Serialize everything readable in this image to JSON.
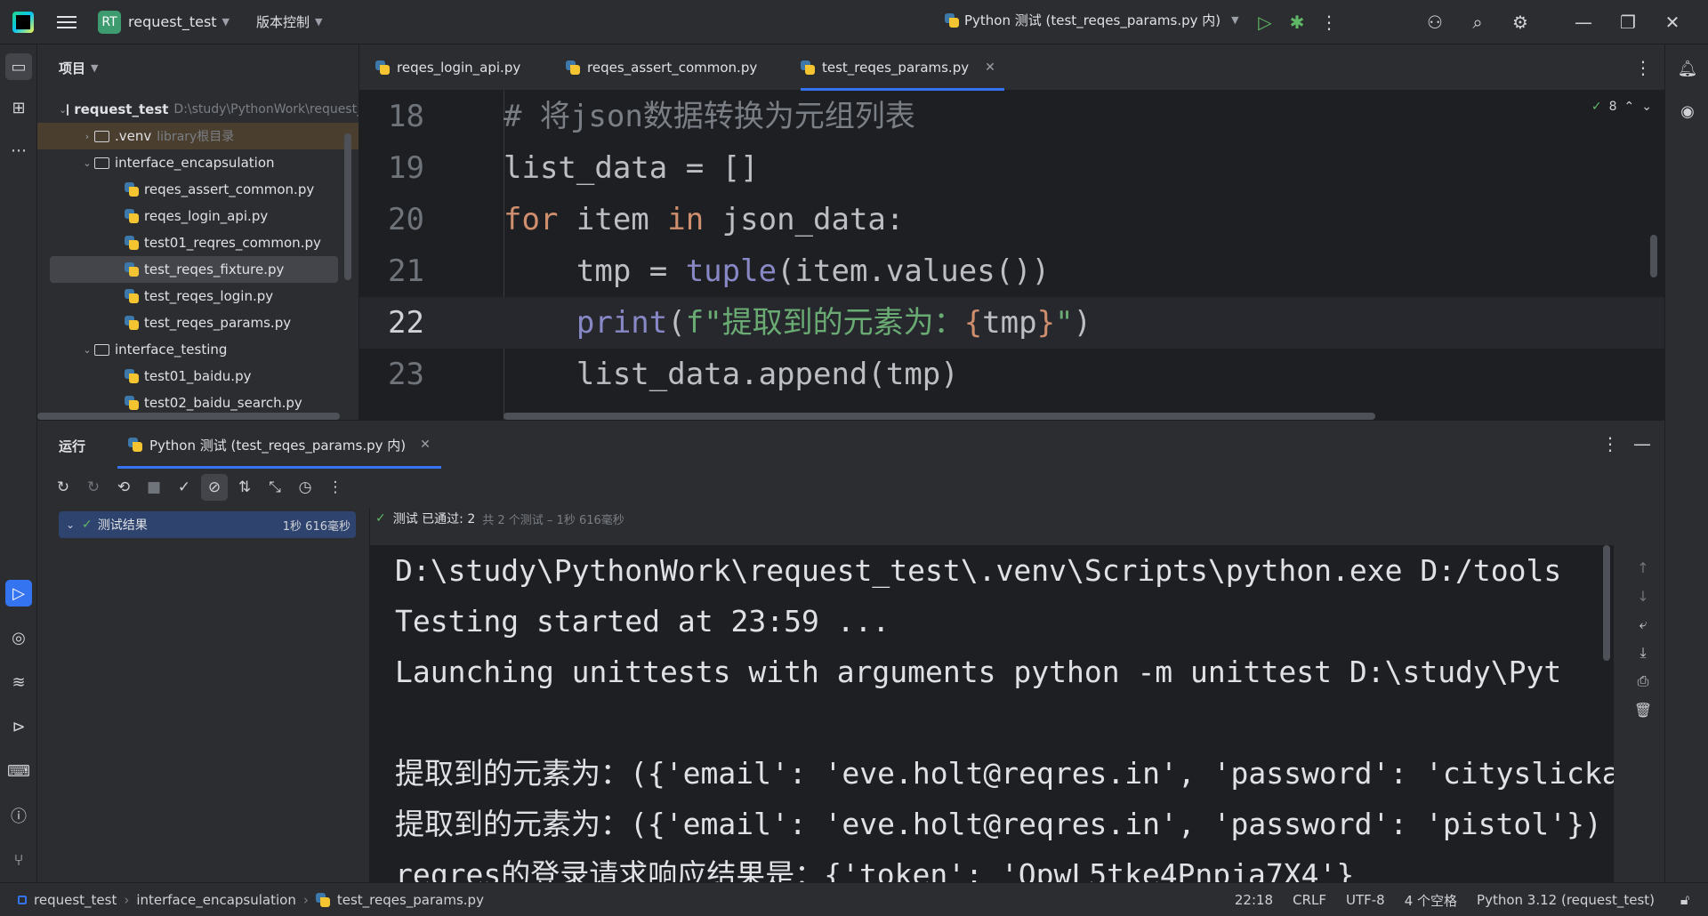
{
  "titlebar": {
    "project_badge": "RT",
    "project_name": "request_test",
    "vcs_label": "版本控制",
    "run_config": "Python 测试 (test_reqes_params.py 内)"
  },
  "project_panel": {
    "title": "项目",
    "rows": [
      {
        "label": "request_test",
        "extra": "D:\\study\\PythonWork\\request_test"
      },
      {
        "label": ".venv",
        "extra": "library根目录"
      },
      {
        "label": "interface_encapsulation"
      },
      {
        "label": "reqes_assert_common.py"
      },
      {
        "label": "reqes_login_api.py"
      },
      {
        "label": "test01_reqres_common.py"
      },
      {
        "label": "test_reqes_fixture.py"
      },
      {
        "label": "test_reqes_login.py"
      },
      {
        "label": "test_reqes_params.py"
      },
      {
        "label": "interface_testing"
      },
      {
        "label": "test01_baidu.py"
      },
      {
        "label": "test02_baidu_search.py"
      }
    ]
  },
  "editor": {
    "tabs": [
      {
        "label": "reqes_login_api.py"
      },
      {
        "label": "reqes_assert_common.py"
      },
      {
        "label": "test_reqes_params.py"
      }
    ],
    "inspection_count": "8",
    "lines": {
      "l18": {
        "num": "18",
        "comment": "# 将json数据转换为元组列表"
      },
      "l19": {
        "num": "19",
        "code": "list_data = []"
      },
      "l20": {
        "num": "20",
        "kw_for": "for",
        "item": " item ",
        "kw_in": "in",
        "rest": " json_data:"
      },
      "l21": {
        "num": "21",
        "lhs": "    tmp = ",
        "fn": "tuple",
        "rest": "(item.values())"
      },
      "l22": {
        "num": "22",
        "indent": "    ",
        "fn": "print",
        "p1": "(",
        "fprefix": "f\"提取到的元素为：",
        "lb": "{",
        "var": "tmp",
        "rb": "}",
        "fsuffix": "\"",
        "p2": ")"
      },
      "l23": {
        "num": "23",
        "code": "    list_data.append(tmp)"
      }
    }
  },
  "run_panel": {
    "title": "运行",
    "tab_label": "Python 测试 (test_reqes_params.py 内)",
    "test_root": "测试结果",
    "test_root_duration": "1秒 616毫秒",
    "status_main": "测试 已通过: 2",
    "status_sub": "共 2 个测试 – 1秒 616毫秒",
    "console": [
      "D:\\study\\PythonWork\\request_test\\.venv\\Scripts\\python.exe D:/tools",
      "Testing started at 23:59 ...",
      "Launching unittests with arguments python -m unittest D:\\study\\Pyt",
      "",
      "提取到的元素为：({'email': 'eve.holt@reqres.in', 'password': 'cityslicka'})",
      "提取到的元素为：({'email': 'eve.holt@reqres.in', 'password': 'pistol'})",
      "reqres的登录请求响应结果是：{'token': 'QpwL5tke4Pnpja7X4'}"
    ]
  },
  "statusbar": {
    "crumbs": [
      "request_test",
      "interface_encapsulation",
      "test_reqes_params.py"
    ],
    "position": "22:18",
    "line_sep": "CRLF",
    "encoding": "UTF-8",
    "indent": "4 个空格",
    "interpreter": "Python 3.12 (request_test)"
  },
  "colors": {
    "accent": "#3574f0",
    "success": "#5fb865",
    "keyword": "#cf8e6d",
    "builtin": "#8888c6",
    "string": "#6aab73"
  }
}
